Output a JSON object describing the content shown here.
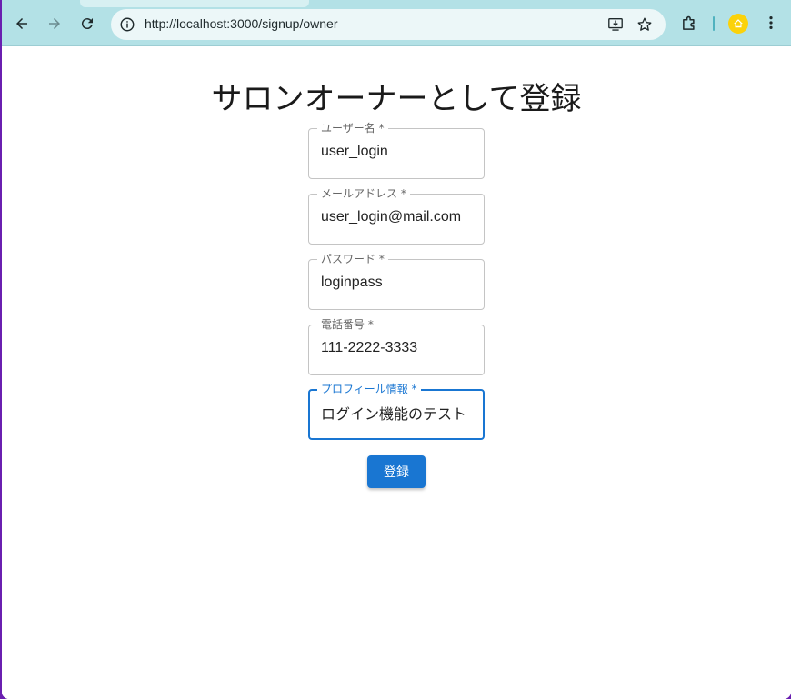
{
  "browser": {
    "url": "http://localhost:3000/signup/owner",
    "accent_color": "#b3e1e6"
  },
  "icons": {
    "back": "back-arrow-icon",
    "forward": "forward-arrow-icon",
    "reload": "reload-icon",
    "info": "info-icon",
    "install": "install-app-icon",
    "bookmark": "star-icon",
    "extensions": "puzzle-icon",
    "profile": "profile-avatar-icon",
    "menu": "kebab-menu-icon"
  },
  "page": {
    "title": "サロンオーナーとして登録",
    "fields": [
      {
        "label": "ユーザー名 *",
        "value": "user_login"
      },
      {
        "label": "メールアドレス *",
        "value": "user_login@mail.com"
      },
      {
        "label": "パスワード *",
        "value": "loginpass"
      },
      {
        "label": "電話番号 *",
        "value": "111-2222-3333"
      },
      {
        "label": "プロフィール情報 *",
        "value": "ログイン機能のテスト"
      }
    ],
    "submit_label": "登録",
    "primary_color": "#1976d2"
  }
}
